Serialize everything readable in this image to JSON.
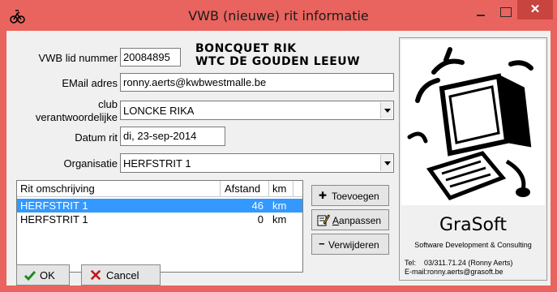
{
  "window": {
    "title": "VWB (nieuwe) rit informatie",
    "close_glyph": "✕",
    "accent_color": "#e9645e"
  },
  "form": {
    "lid_label": "VWB lid nummer",
    "lid_value": "20084895",
    "member_name": "BONCQUET RIK",
    "member_club": "WTC DE GOUDEN LEEUW",
    "email_label": "EMail adres",
    "email_value": "ronny.aerts@kwbwestmalle.be",
    "club_label_line1": "club",
    "club_label_line2": "verantwoordelijke",
    "club_value": "LONCKE RIKA",
    "datum_label": "Datum rit",
    "datum_value": "di, 23-sep-2014",
    "org_label": "Organisatie",
    "org_value": "HERFSTRIT 1"
  },
  "grid": {
    "headers": [
      "Rit omschrijving",
      "Afstand",
      "km"
    ],
    "rows": [
      {
        "omschrijving": "HERFSTRIT 1",
        "afstand": "46",
        "unit": "km",
        "selected": true
      },
      {
        "omschrijving": "HERFSTRIT 1",
        "afstand": "0",
        "unit": "km",
        "selected": false
      }
    ]
  },
  "buttons": {
    "add": "Toevoegen",
    "add_icon": "plus-icon",
    "edit_prefix": "",
    "edit_underlined": "A",
    "edit_rest": "anpassen",
    "edit_icon": "edit-icon",
    "remove": "Verwijderen",
    "remove_icon": "minus-icon",
    "ok": "OK",
    "ok_icon": "checkmark-icon",
    "cancel": "Cancel",
    "cancel_icon": "cross-icon"
  },
  "brand": {
    "name": "GraSoft",
    "tagline": "Software Development & Consulting",
    "tel_label": "Tel:",
    "tel_value": "03/311.71.24 (Ronny Aerts)",
    "email_line": "E-mail:ronny.aerts@grasoft.be"
  }
}
